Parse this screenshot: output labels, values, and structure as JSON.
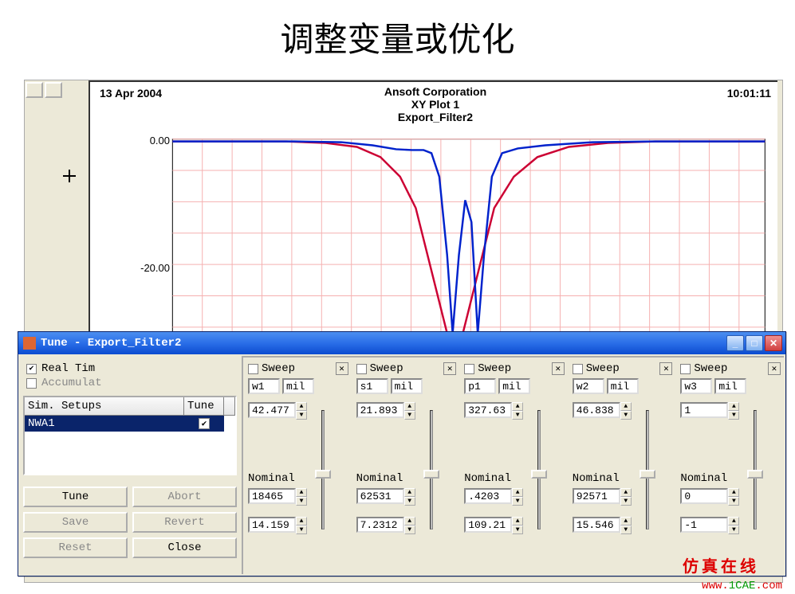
{
  "page": {
    "title": "调整变量或优化"
  },
  "plot": {
    "date": "13 Apr 2004",
    "title1": "Ansoft Corporation",
    "title2": "XY Plot 1",
    "title3": "Export_Filter2",
    "time": "10:01:11",
    "yticks": [
      "0.00",
      "-20.00"
    ]
  },
  "chart_data": {
    "type": "line",
    "title": "XY Plot 1 — Export_Filter2",
    "xlabel": "",
    "ylabel": "",
    "ylim": [
      -30,
      2
    ],
    "xlim": [
      0,
      100
    ],
    "series": [
      {
        "name": "red",
        "color": "#cc0033",
        "x": [
          0,
          10,
          20,
          25,
          30,
          35,
          40,
          42,
          45,
          48,
          50,
          52,
          55,
          58,
          60,
          65,
          70,
          75,
          80,
          90,
          100
        ],
        "y": [
          -0.2,
          -0.2,
          -0.3,
          -0.4,
          -0.7,
          -1.5,
          -3,
          -5,
          -10,
          -22,
          -30,
          -22,
          -10,
          -5,
          -3,
          -1.5,
          -0.7,
          -0.4,
          -0.3,
          -0.2,
          -0.2
        ]
      },
      {
        "name": "blue",
        "color": "#0022cc",
        "x": [
          0,
          10,
          20,
          25,
          30,
          35,
          38,
          40,
          42,
          44,
          46,
          48,
          50,
          52,
          54,
          56,
          58,
          60,
          62,
          64,
          66,
          70,
          75,
          80,
          90,
          100
        ],
        "y": [
          -0.2,
          -0.2,
          -0.2,
          -0.2,
          -0.3,
          -0.6,
          -1.0,
          -1.2,
          -1.3,
          -1.3,
          -1.5,
          -4,
          -18,
          -30,
          -15,
          -9,
          -13,
          -30,
          -15,
          -4,
          -1.5,
          -0.8,
          -0.4,
          -0.3,
          -0.2,
          -0.2
        ]
      }
    ]
  },
  "tune_dialog": {
    "title": "Tune - Export_Filter2",
    "realtime_label": "Real Tim",
    "accumulate_label": "Accumulat",
    "realtime_checked": true,
    "table": {
      "col_sim": "Sim. Setups",
      "col_tune": "Tune",
      "row_name": "NWA1",
      "row_checked": true
    },
    "buttons": {
      "tune": "Tune",
      "abort": "Abort",
      "save": "Save",
      "revert": "Revert",
      "reset": "Reset",
      "close": "Close"
    },
    "sweep_label": "Sweep",
    "nominal_label": "Nominal",
    "tuners": [
      {
        "name": "w1",
        "unit": "mil",
        "max": "42.477",
        "nominal": "18465",
        "min": "14.159",
        "thumb": 0.5
      },
      {
        "name": "s1",
        "unit": "mil",
        "max": "21.893",
        "nominal": "62531",
        "min": "7.2312",
        "thumb": 0.5
      },
      {
        "name": "p1",
        "unit": "mil",
        "max": "327.63",
        "nominal": ".4203",
        "min": "109.21",
        "thumb": 0.5
      },
      {
        "name": "w2",
        "unit": "mil",
        "max": "46.838",
        "nominal": "92571",
        "min": "15.546",
        "thumb": 0.5
      },
      {
        "name": "w3",
        "unit": "mil",
        "max": "1",
        "nominal": "0",
        "min": "-1",
        "thumb": 0.5
      }
    ]
  },
  "watermark": {
    "cn": "仿真在线",
    "url_pre": "www.",
    "url_mid": "1CAE",
    "url_post": ".com"
  }
}
